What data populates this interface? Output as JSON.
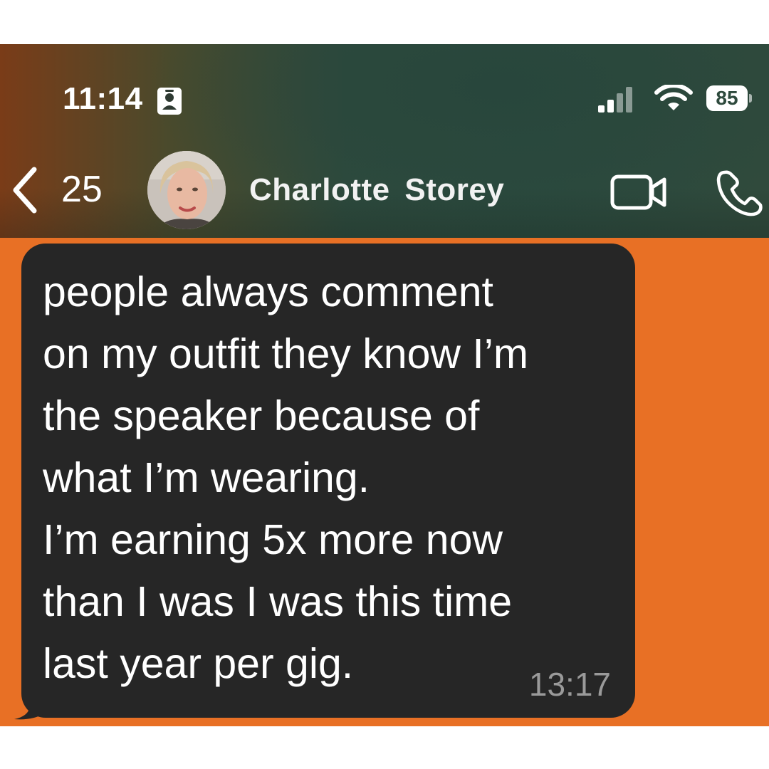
{
  "status_bar": {
    "time": "11:14",
    "battery": "85",
    "icons": [
      "id-badge-icon",
      "signal-icon",
      "wifi-icon",
      "battery-icon"
    ]
  },
  "header": {
    "back_count": "25",
    "contact_name": "Charlotte  Storey",
    "icons": [
      "chevron-left-icon",
      "avatar",
      "video-call-icon",
      "phone-call-icon"
    ]
  },
  "message": {
    "lines": [
      "people always comment",
      "on my outfit they know I’m",
      "the speaker because of",
      "what I’m wearing.",
      "I’m earning 5x more now",
      "than I was I was this time",
      "last year per gig."
    ],
    "timestamp": "13:17"
  },
  "colors": {
    "chat_background": "#e87025",
    "bubble": "#262626",
    "header": "#2d4a3d"
  }
}
